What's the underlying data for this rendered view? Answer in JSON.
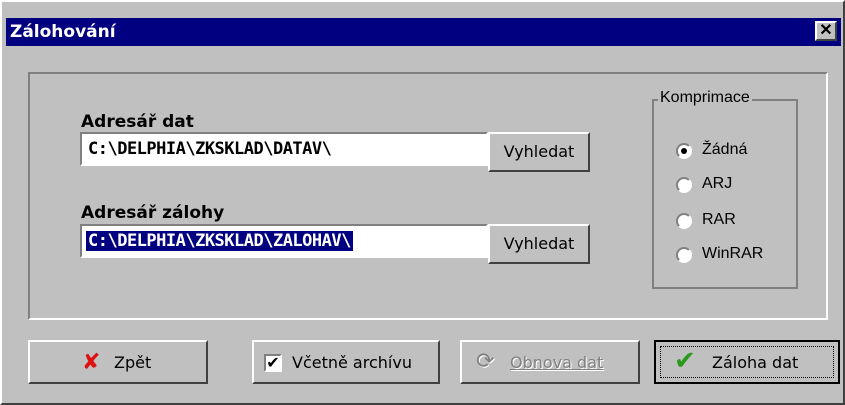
{
  "window": {
    "title": "Zálohování",
    "close": "✕"
  },
  "data_dir": {
    "label": "Adresář dat",
    "value": "C:\\DELPHIA\\ZKSKLAD\\DATAV\\",
    "button": "Vyhledat"
  },
  "backup_dir": {
    "label": "Adresář zálohy",
    "value": "C:\\DELPHIA\\ZKSKLAD\\ZALOHAV\\",
    "button": "Vyhledat"
  },
  "compression": {
    "title": "Komprimace",
    "options": [
      {
        "label": "Žádná",
        "selected": true
      },
      {
        "label": "ARJ",
        "selected": false
      },
      {
        "label": "RAR",
        "selected": false
      },
      {
        "label": "WinRAR",
        "selected": false
      }
    ]
  },
  "footer": {
    "back": {
      "label": "Zpět",
      "icon": "red-x-icon"
    },
    "include_archive": {
      "label": "Včetně archívu",
      "checked": true
    },
    "restore": {
      "label": "Obnova dat",
      "enabled": false,
      "icon": "refresh-icon"
    },
    "backup": {
      "label": "Záloha dat",
      "icon": "green-check-icon"
    }
  },
  "colors": {
    "titlebar": "#000080",
    "face": "#c0c0c0",
    "check": "#2a9a1a",
    "x": "#e01010"
  }
}
